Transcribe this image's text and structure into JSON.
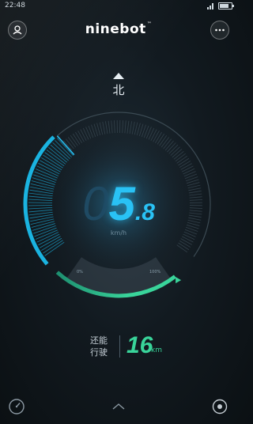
{
  "status_bar": {
    "time": "22:48",
    "battery_level": 0.8
  },
  "header": {
    "brand": "ninebot",
    "brand_mark": "™",
    "left_icon": "person-icon",
    "right_icon": "more-icon"
  },
  "heading": {
    "direction": "北",
    "icon": "heading-arrow-icon"
  },
  "speedometer": {
    "ghost_digit": "0",
    "speed_int": "5",
    "speed_decimal": ".8",
    "unit": "km/h",
    "battery_min_label": "0%",
    "battery_max_label": "100%",
    "accent_color": "#29c2f5",
    "range_color": "#39d49a"
  },
  "range": {
    "label_line1": "还能",
    "label_line2": "行驶",
    "value": "16",
    "unit": "km"
  },
  "bottom_bar": {
    "left_icon": "gauge-icon",
    "center_icon": "chevron-up-icon",
    "right_icon": "target-icon"
  }
}
